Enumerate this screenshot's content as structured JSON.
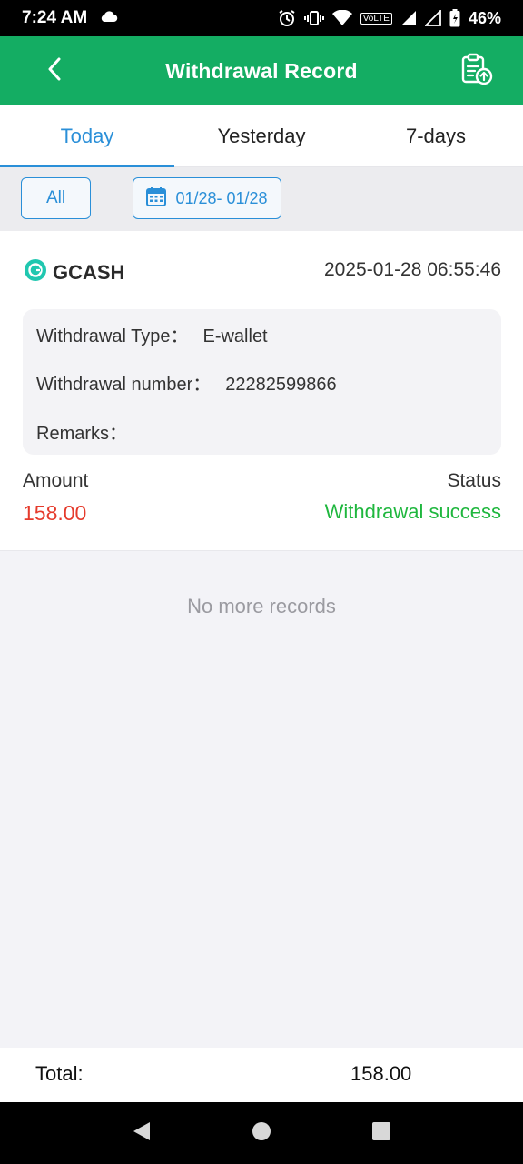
{
  "status_bar": {
    "time": "7:24 AM",
    "battery": "46%",
    "volte": "VoLTE",
    "icons": [
      "cloud-icon",
      "alarm-icon",
      "vibrate-icon",
      "wifi-icon",
      "signal-icon",
      "battery-icon"
    ]
  },
  "header": {
    "title": "Withdrawal Record",
    "back_icon": "chevron-left-icon",
    "action_icon": "clipboard-upload-icon"
  },
  "tabs": [
    {
      "label": "Today",
      "active": true
    },
    {
      "label": "Yesterday",
      "active": false
    },
    {
      "label": "7-days",
      "active": false
    }
  ],
  "filters": {
    "all_label": "All",
    "date_range": "01/28- 01/28",
    "date_icon": "calendar-icon"
  },
  "record": {
    "provider": "GCASH",
    "datetime": "2025-01-28 06:55:46",
    "type_label": "Withdrawal Type：",
    "type_value": "E-wallet",
    "number_label": "Withdrawal number：",
    "number_value": "22282599866",
    "remarks_label": "Remarks：",
    "remarks_value": "",
    "amount_label": "Amount",
    "amount_value": "158.00",
    "status_label": "Status",
    "status_value": "Withdrawal success"
  },
  "list_footer": {
    "no_more": "No more records"
  },
  "total": {
    "label": "Total:",
    "value": "158.00"
  },
  "colors": {
    "header_green": "#14ad63",
    "accent_blue": "#2a8fd8",
    "amount_red": "#e53b2c",
    "success_green": "#1fb73e"
  }
}
